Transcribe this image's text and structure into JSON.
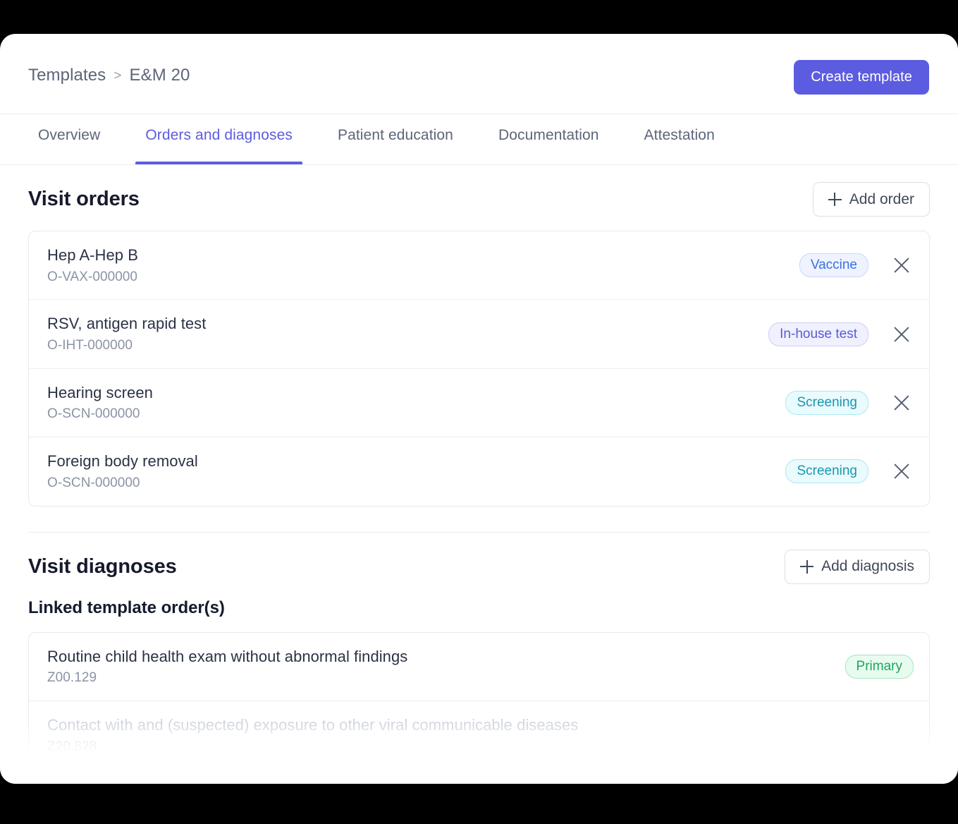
{
  "header": {
    "breadcrumb": {
      "root": "Templates",
      "separator": ">",
      "current": "E&M 20"
    },
    "create_button": "Create template",
    "accent_color": "#5c5ce0"
  },
  "tabs": [
    {
      "label": "Overview",
      "active": false
    },
    {
      "label": "Orders and diagnoses",
      "active": true
    },
    {
      "label": "Patient education",
      "active": false
    },
    {
      "label": "Documentation",
      "active": false
    },
    {
      "label": "Attestation",
      "active": false
    }
  ],
  "visit_orders": {
    "title": "Visit orders",
    "add_button": "Add order",
    "add_icon": "plus-icon",
    "remove_icon": "close-icon",
    "rows": [
      {
        "name": "Hep A-Hep B",
        "code": "O-VAX-000000",
        "badge": "Vaccine",
        "badge_type": "vaccine",
        "badge_color": "#3b6fe0"
      },
      {
        "name": "RSV, antigen rapid test",
        "code": "O-IHT-000000",
        "badge": "In-house test",
        "badge_type": "inhouse",
        "badge_color": "#5a5ad6"
      },
      {
        "name": "Hearing screen",
        "code": "O-SCN-000000",
        "badge": "Screening",
        "badge_type": "screening",
        "badge_color": "#1b96ae"
      },
      {
        "name": "Foreign body removal",
        "code": "O-SCN-000000",
        "badge": "Screening",
        "badge_type": "screening",
        "badge_color": "#1b96ae"
      }
    ]
  },
  "visit_diagnoses": {
    "title": "Visit diagnoses",
    "add_button": "Add diagnosis",
    "add_icon": "plus-icon",
    "subsection_title": "Linked template order(s)",
    "rows": [
      {
        "name": "Routine child health exam without abnormal findings",
        "code": "Z00.129",
        "badge": "Primary",
        "badge_type": "primary",
        "badge_color": "#1da75b"
      },
      {
        "name": "Contact with and (suspected) exposure to other viral communicable diseases",
        "code": "Z20.828",
        "badge": "",
        "badge_type": "",
        "badge_color": ""
      }
    ]
  }
}
